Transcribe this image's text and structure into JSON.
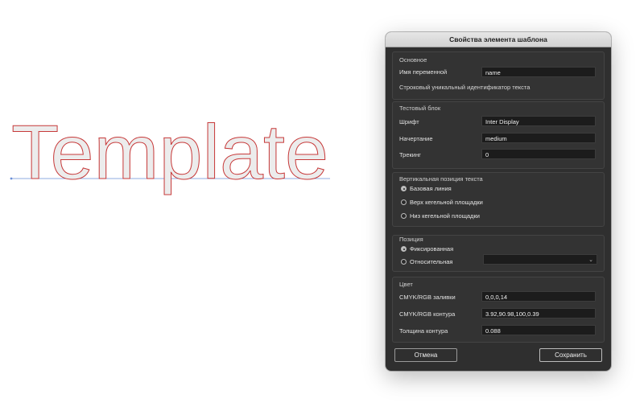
{
  "canvas": {
    "template_text": "Template",
    "colors": {
      "fill": "#ececec",
      "stroke": "#c73a3a",
      "baseline": "#6a8fd8"
    }
  },
  "dialog": {
    "title": "Свойства элемента шаблона",
    "basic": {
      "group_label": "Основное",
      "var_name_label": "Имя переменной",
      "var_name_value": "name",
      "description": "Строковый уникальный идентификатор текста"
    },
    "text_block": {
      "group_label": "Тестовый блок",
      "font_label": "Шрифт",
      "font_value": "Inter Display",
      "style_label": "Начертание",
      "style_value": "medium",
      "tracking_label": "Трекинг",
      "tracking_value": "0"
    },
    "vertical_position": {
      "group_label": "Вертикальная позиция текста",
      "options": [
        {
          "label": "Базовая линия",
          "checked": true
        },
        {
          "label": "Верх кегельной площадки",
          "checked": false
        },
        {
          "label": "Низ кегельной площадки",
          "checked": false
        }
      ]
    },
    "position": {
      "group_label": "Позиция",
      "fixed_label": "Фиксированная",
      "fixed_checked": true,
      "relative_label": "Относительная",
      "relative_checked": false,
      "relative_select_value": ""
    },
    "color": {
      "group_label": "Цвет",
      "fill_label": "CMYK/RGB заливки",
      "fill_value": "0,0,0,14",
      "stroke_label": "CMYK/RGB контура",
      "stroke_value": "3.92,90.98,100,0.39",
      "stroke_width_label": "Толщина контура",
      "stroke_width_value": "0.088"
    },
    "buttons": {
      "cancel": "Отмена",
      "save": "Сохранить"
    }
  }
}
